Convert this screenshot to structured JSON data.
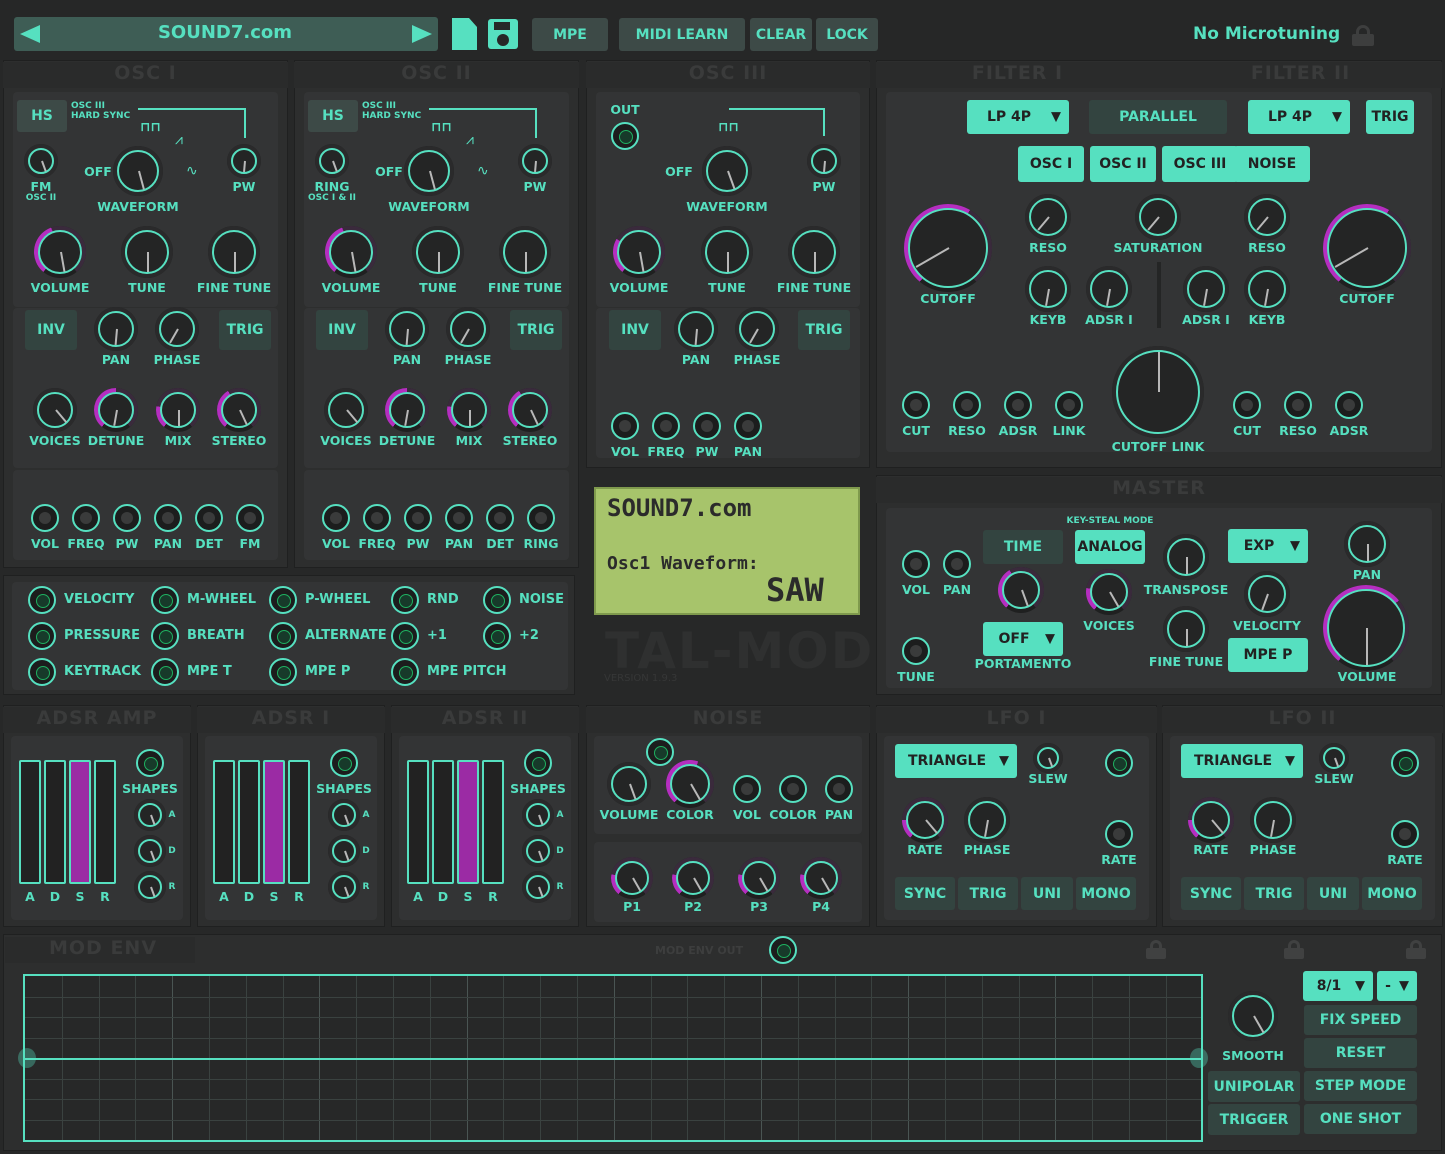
{
  "colors": {
    "accent": "#56e0c0",
    "mod": "#b52ec0",
    "bg": "#272828"
  },
  "topbar": {
    "preset": "SOUND7.com",
    "mpe": "MPE",
    "midi_learn": "MIDI LEARN",
    "clear": "CLEAR",
    "lock": "LOCK",
    "microtuning": "No Microtuning",
    "icons": [
      "arrow-left-icon",
      "arrow-right-icon",
      "file-icon",
      "save-icon",
      "lock-icon"
    ]
  },
  "osc1": {
    "title": "OSC I",
    "hs": "HS",
    "hs_note": "OSC III HARD SYNC",
    "fm": "FM",
    "fm_sub": "OSC II",
    "off": "OFF",
    "pw": "PW",
    "waveform": "WAVEFORM",
    "volume": "VOLUME",
    "tune": "TUNE",
    "fine_tune": "FINE TUNE",
    "inv": "INV",
    "pan": "PAN",
    "phase": "PHASE",
    "trig": "TRIG",
    "voices": "VOICES",
    "detune": "DETUNE",
    "mix": "MIX",
    "stereo": "STEREO",
    "jacks": [
      "VOL",
      "FREQ",
      "PW",
      "PAN",
      "DET",
      "FM"
    ]
  },
  "osc2": {
    "title": "OSC II",
    "hs": "HS",
    "hs_note": "OSC III HARD SYNC",
    "ring": "RING",
    "ring_sub": "OSC I & II",
    "off": "OFF",
    "pw": "PW",
    "waveform": "WAVEFORM",
    "volume": "VOLUME",
    "tune": "TUNE",
    "fine_tune": "FINE TUNE",
    "inv": "INV",
    "pan": "PAN",
    "phase": "PHASE",
    "trig": "TRIG",
    "voices": "VOICES",
    "detune": "DETUNE",
    "mix": "MIX",
    "stereo": "STEREO",
    "jacks": [
      "VOL",
      "FREQ",
      "PW",
      "PAN",
      "DET",
      "RING"
    ]
  },
  "osc3": {
    "title": "OSC III",
    "out": "OUT",
    "off": "OFF",
    "pw": "PW",
    "waveform": "WAVEFORM",
    "volume": "VOLUME",
    "tune": "TUNE",
    "fine_tune": "FINE TUNE",
    "inv": "INV",
    "pan": "PAN",
    "phase": "PHASE",
    "trig": "TRIG",
    "jacks": [
      "VOL",
      "FREQ",
      "PW",
      "PAN"
    ]
  },
  "filters": {
    "title1": "FILTER I",
    "title2": "FILTER II",
    "type1": "LP 4P",
    "mode": "PARALLEL",
    "type2": "LP 4P",
    "trig": "TRIG",
    "sources": [
      "OSC I",
      "OSC II",
      "OSC III",
      "NOISE"
    ],
    "cutoff": "CUTOFF",
    "reso": "RESO",
    "saturation": "SATURATION",
    "keyb": "KEYB",
    "adsr1": "ADSR I",
    "cutoff_link": "CUTOFF LINK",
    "jacks1": [
      "CUT",
      "RESO",
      "ADSR",
      "LINK"
    ],
    "jacks2": [
      "CUT",
      "RESO",
      "ADSR"
    ]
  },
  "mod_sources": [
    "VELOCITY",
    "M-WHEEL",
    "P-WHEEL",
    "RND",
    "NOISE",
    "PRESSURE",
    "BREATH",
    "ALTERNATE",
    "+1",
    "+2",
    "KEYTRACK",
    "MPE T",
    "MPE P",
    "MPE PITCH"
  ],
  "lcd": {
    "line1": "SOUND7.com",
    "line2": "Osc1 Waveform:",
    "line3": "SAW"
  },
  "logo": {
    "name": "TAL-MOD",
    "version": "VERSION 1.9.3"
  },
  "master": {
    "title": "MASTER",
    "vol": "VOL",
    "pan": "PAN",
    "tune": "TUNE",
    "time": "TIME",
    "key_steal": "KEY-STEAL MODE",
    "analog": "ANALOG",
    "portamento_mode": "OFF",
    "portamento": "PORTAMENTO",
    "voices": "VOICES",
    "transpose": "TRANSPOSE",
    "fine_tune": "FINE TUNE",
    "exp": "EXP",
    "velocity": "VELOCITY",
    "mpe_p": "MPE P",
    "pan_k": "PAN",
    "volume": "VOLUME"
  },
  "adsr_amp": {
    "title": "ADSR AMP",
    "shapes": "SHAPES",
    "letters": [
      "A",
      "D",
      "S",
      "R"
    ],
    "shape_letters": [
      "A",
      "D",
      "R"
    ]
  },
  "adsr1": {
    "title": "ADSR I",
    "shapes": "SHAPES",
    "letters": [
      "A",
      "D",
      "S",
      "R"
    ],
    "shape_letters": [
      "A",
      "D",
      "R"
    ]
  },
  "adsr2": {
    "title": "ADSR II",
    "shapes": "SHAPES",
    "letters": [
      "A",
      "D",
      "S",
      "R"
    ],
    "shape_letters": [
      "A",
      "D",
      "R"
    ]
  },
  "noise": {
    "title": "NOISE",
    "volume": "VOLUME",
    "color": "COLOR",
    "jacks": [
      "VOL",
      "COLOR",
      "PAN"
    ],
    "p": [
      "P1",
      "P2",
      "P3",
      "P4"
    ]
  },
  "lfo1": {
    "title": "LFO I",
    "wave": "TRIANGLE",
    "slew": "SLEW",
    "rate": "RATE",
    "phase": "PHASE",
    "rate_jack": "RATE",
    "buttons": [
      "SYNC",
      "TRIG",
      "UNI",
      "MONO"
    ]
  },
  "lfo2": {
    "title": "LFO II",
    "wave": "TRIANGLE",
    "slew": "SLEW",
    "rate": "RATE",
    "phase": "PHASE",
    "rate_jack": "RATE",
    "buttons": [
      "SYNC",
      "TRIG",
      "UNI",
      "MONO"
    ]
  },
  "modenv": {
    "title": "MOD ENV",
    "out": "MOD ENV OUT",
    "speed": "8/1",
    "dash": "-",
    "smooth": "SMOOTH",
    "buttons": [
      "FIX SPEED",
      "RESET",
      "STEP MODE",
      "ONE SHOT"
    ],
    "unipolar": "UNIPOLAR",
    "trigger": "TRIGGER"
  }
}
